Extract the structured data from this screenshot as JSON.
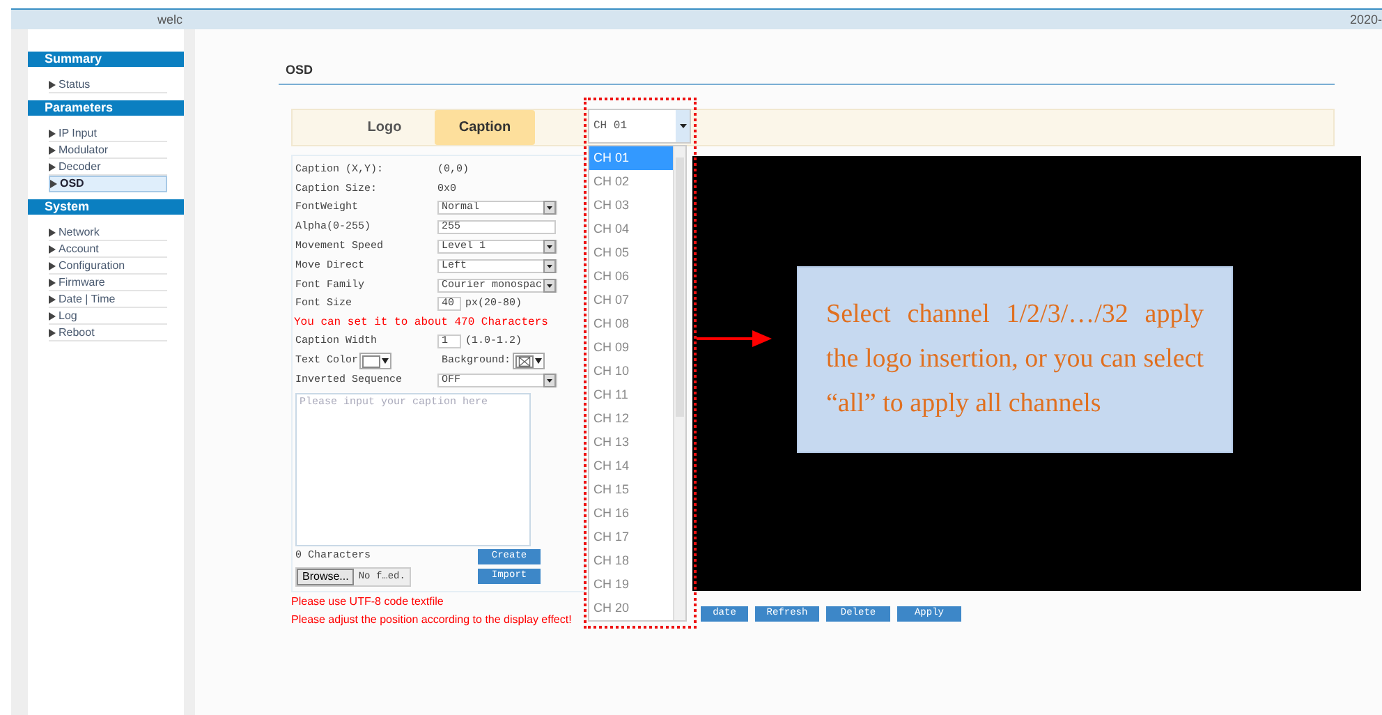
{
  "top_bar": {
    "left_text": "welc",
    "right_text": "2020-"
  },
  "sidebar": [
    {
      "title": "Summary",
      "items": [
        {
          "label": "Status",
          "selected": false
        }
      ]
    },
    {
      "title": "Parameters",
      "items": [
        {
          "label": "IP Input",
          "selected": false
        },
        {
          "label": "Modulator",
          "selected": false
        },
        {
          "label": "Decoder",
          "selected": false
        },
        {
          "label": "OSD",
          "selected": true
        }
      ]
    },
    {
      "title": "System",
      "items": [
        {
          "label": "Network",
          "selected": false
        },
        {
          "label": "Account",
          "selected": false
        },
        {
          "label": "Configuration",
          "selected": false
        },
        {
          "label": "Firmware",
          "selected": false
        },
        {
          "label": "Date | Time",
          "selected": false
        },
        {
          "label": "Log",
          "selected": false
        },
        {
          "label": "Reboot",
          "selected": false
        }
      ]
    }
  ],
  "page_title": "OSD",
  "tabs": [
    {
      "label": "Logo",
      "selected": false
    },
    {
      "label": "Caption",
      "selected": true
    }
  ],
  "channel_select": {
    "value": "CH 01",
    "options": [
      {
        "label": "CH 01",
        "selected": true
      },
      {
        "label": "CH 02",
        "selected": false
      },
      {
        "label": "CH 03",
        "selected": false
      },
      {
        "label": "CH 04",
        "selected": false
      },
      {
        "label": "CH 05",
        "selected": false
      },
      {
        "label": "CH 06",
        "selected": false
      },
      {
        "label": "CH 07",
        "selected": false
      },
      {
        "label": "CH 08",
        "selected": false
      },
      {
        "label": "CH 09",
        "selected": false
      },
      {
        "label": "CH 10",
        "selected": false
      },
      {
        "label": "CH 11",
        "selected": false
      },
      {
        "label": "CH 12",
        "selected": false
      },
      {
        "label": "CH 13",
        "selected": false
      },
      {
        "label": "CH 14",
        "selected": false
      },
      {
        "label": "CH 15",
        "selected": false
      },
      {
        "label": "CH 16",
        "selected": false
      },
      {
        "label": "CH 17",
        "selected": false
      },
      {
        "label": "CH 18",
        "selected": false
      },
      {
        "label": "CH 19",
        "selected": false
      },
      {
        "label": "CH 20",
        "selected": false
      }
    ]
  },
  "form": {
    "rows": [
      {
        "kind": "static",
        "label": "Caption (X,Y):",
        "value": "(0,0)"
      },
      {
        "kind": "static",
        "label": "Caption Size:",
        "value": "0x0"
      },
      {
        "kind": "select",
        "label": "FontWeight",
        "value": "Normal"
      },
      {
        "kind": "input",
        "label": "Alpha(0-255)",
        "value": "255"
      },
      {
        "kind": "select",
        "label": "Movement Speed",
        "value": "Level 1"
      },
      {
        "kind": "select",
        "label": "Move Direct",
        "value": "Left"
      },
      {
        "kind": "select",
        "label": "Font Family",
        "value": "Courier monospac"
      },
      {
        "kind": "short",
        "label": "Font Size",
        "value": "40",
        "suffix": "px(20-80)"
      },
      {
        "kind": "note",
        "label": "You can set it to about 470 Characters"
      },
      {
        "kind": "short",
        "label": "Caption Width",
        "value": "1",
        "suffix": "(1.0-1.2)"
      },
      {
        "kind": "colors",
        "label": "Text Color",
        "second_label": "Background:"
      },
      {
        "kind": "select",
        "label": "Inverted Sequence",
        "value": "OFF"
      }
    ],
    "textarea_placeholder": "Please input your caption here",
    "char_count": "0 Characters",
    "create_button": "Create",
    "browse_button": "Browse...",
    "file_label": "No f…ed.",
    "import_button": "Import",
    "notes": [
      "Please use UTF-8 code textfile",
      "Please adjust the position according to the display effect!"
    ]
  },
  "action_buttons": [
    "date",
    "Refresh",
    "Delete",
    "Apply"
  ],
  "callout": "Select channel 1/2/3/…/32 apply the logo insertion, or you can select “all” to apply all channels"
}
